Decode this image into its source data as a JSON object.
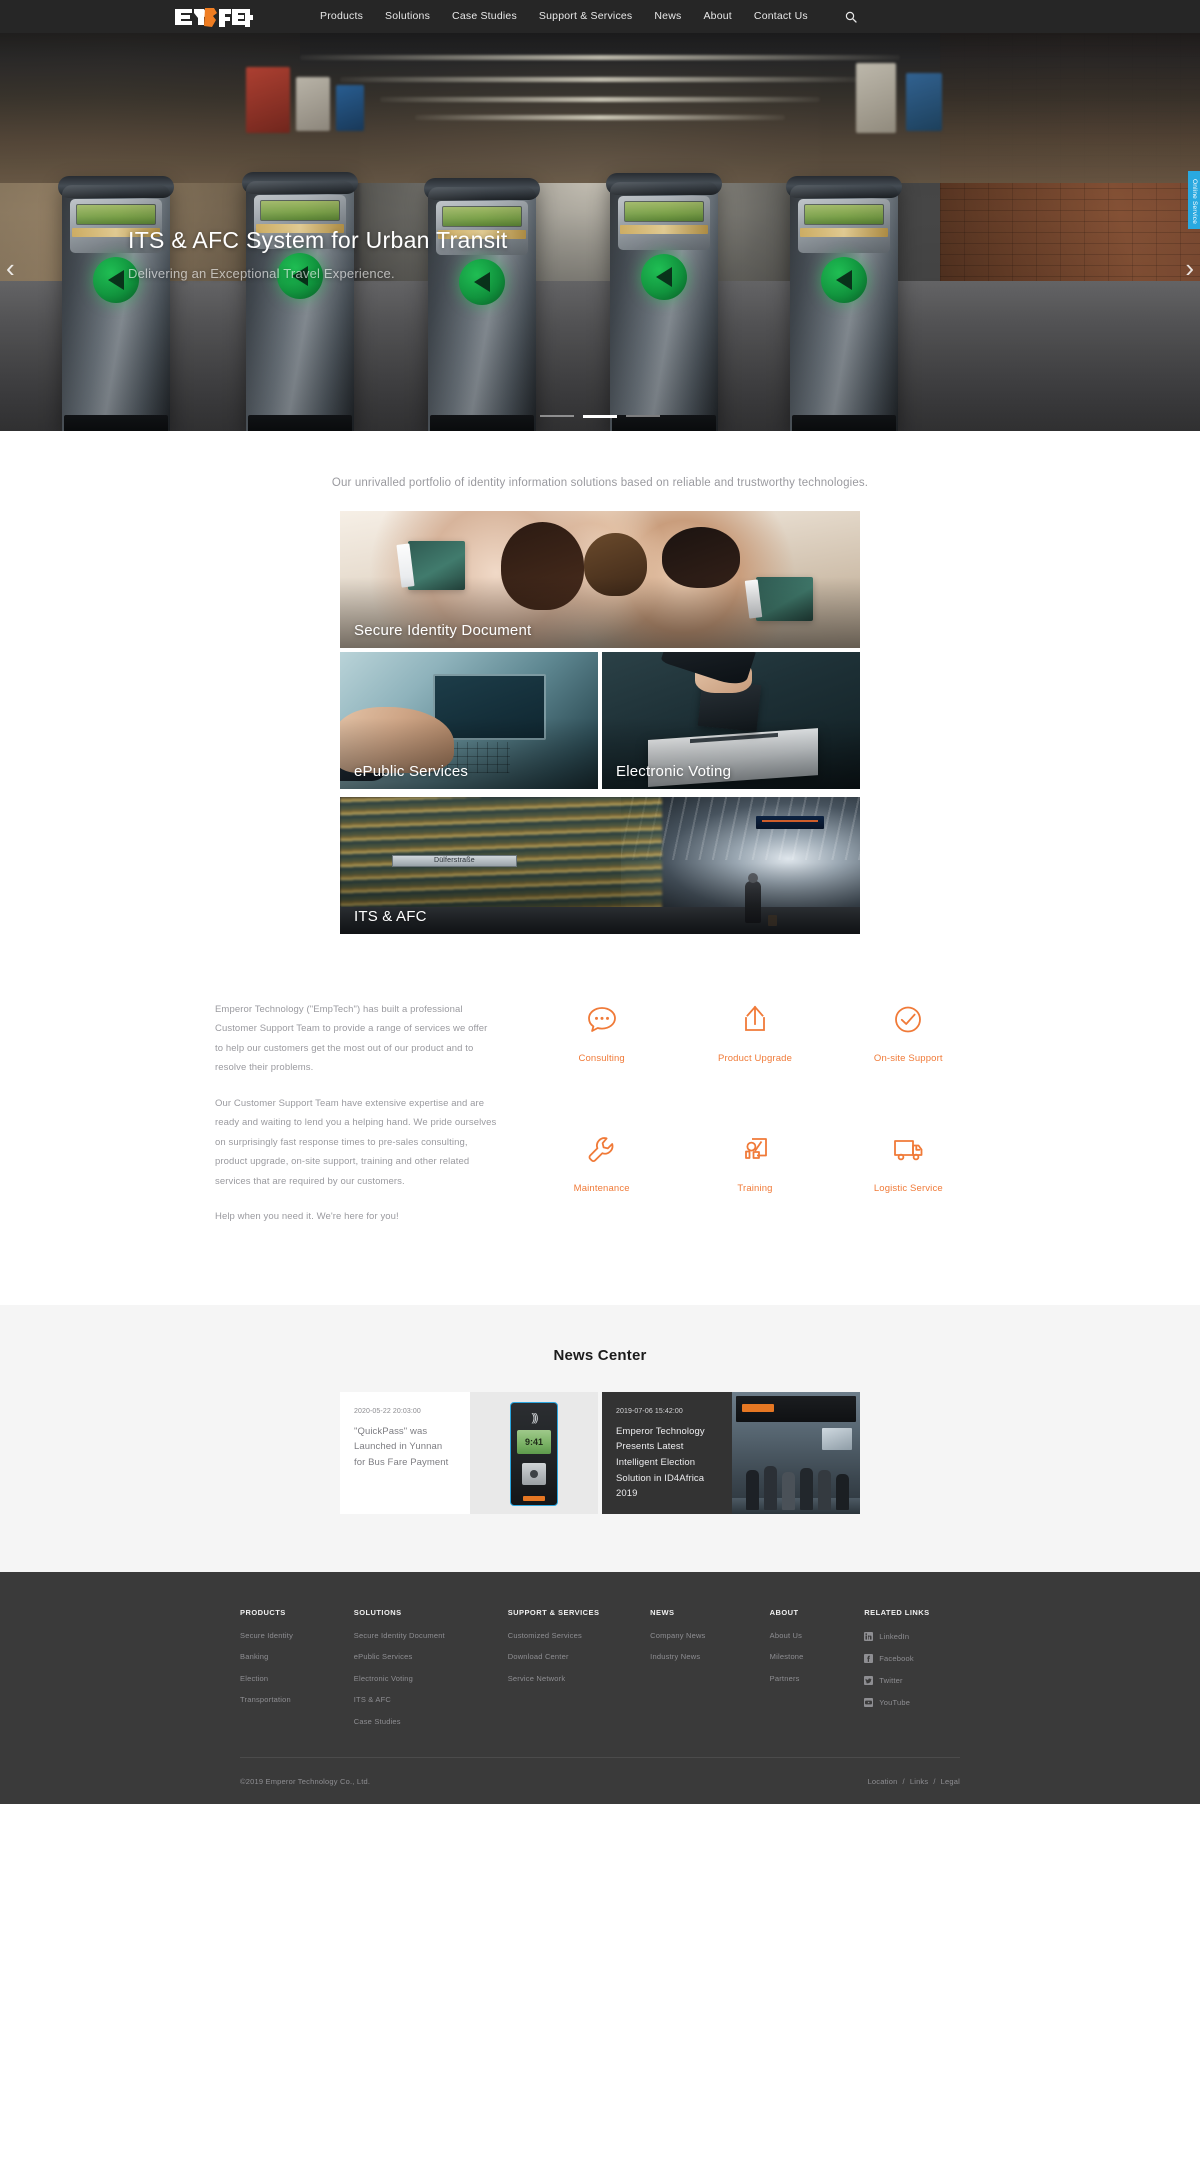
{
  "header": {
    "logo_text": "EMPTECH",
    "nav": [
      {
        "label": "Products"
      },
      {
        "label": "Solutions"
      },
      {
        "label": "Case Studies"
      },
      {
        "label": "Support & Services"
      },
      {
        "label": "News"
      },
      {
        "label": "About"
      },
      {
        "label": "Contact Us"
      }
    ],
    "search_icon": "search-icon"
  },
  "hero": {
    "title": "ITS & AFC System for Urban Transit",
    "subtitle": "Delivering an Exceptional Travel Experience.",
    "prev_label": "‹",
    "next_label": "›",
    "slide_count": 3,
    "active_slide": 2,
    "online_service_tab": "Online Service"
  },
  "tagline": "Our unrivalled portfolio of identity information solutions based on reliable and trustworthy technologies.",
  "tiles": [
    {
      "label": "Secure Identity Document",
      "art": "family-passport"
    },
    {
      "label": "ePublic Services",
      "art": "atm-kiosk"
    },
    {
      "label": "Electronic Voting",
      "art": "ballot-box"
    },
    {
      "label": "ITS & AFC",
      "art": "metro-platform",
      "sign_text": "Dülferstraße"
    }
  ],
  "support": {
    "paragraphs": [
      "Emperor Technology (\"EmpTech\") has built a professional Customer Support Team to provide a range of services we offer to help our customers get the most out of our product and to resolve their problems.",
      "Our Customer Support Team have extensive expertise and are ready and waiting to lend you a helping hand. We pride ourselves on surprisingly fast response times to pre-sales consulting, product upgrade, on-site support, training and other related services that are required by our customers.",
      "Help when you need it. We're here for you!"
    ],
    "accent_color": "#f07a38",
    "services": [
      {
        "label": "Consulting",
        "icon": "chat-bubble-icon"
      },
      {
        "label": "Product Upgrade",
        "icon": "upload-icon"
      },
      {
        "label": "On-site Support",
        "icon": "check-circle-icon"
      },
      {
        "label": "Maintenance",
        "icon": "wrench-icon"
      },
      {
        "label": "Training",
        "icon": "presentation-icon"
      },
      {
        "label": "Logistic Service",
        "icon": "delivery-truck-icon"
      }
    ]
  },
  "news": {
    "title": "News Center",
    "cards": [
      {
        "date": "2020-05-22 20:03:00",
        "headline": "\"QuickPass\" was Launched in Yunnan for Bus Fare Payment",
        "theme": "light",
        "image": "bus-validator-device",
        "device_time": "9:41"
      },
      {
        "date": "2019-07-06 15:42:00",
        "headline": "Emperor Technology Presents Latest Intelligent Election Solution in ID4Africa 2019",
        "theme": "dark",
        "image": "exhibition-booth"
      }
    ]
  },
  "footer": {
    "columns": [
      {
        "title": "PRODUCTS",
        "links": [
          "Secure Identity",
          "Banking",
          "Election",
          "Transportation"
        ]
      },
      {
        "title": "SOLUTIONS",
        "links": [
          "Secure Identity Document",
          "ePublic Services",
          "Electronic Voting",
          "ITS & AFC",
          "Case Studies"
        ]
      },
      {
        "title": "SUPPORT & SERVICES",
        "links": [
          "Customized Services",
          "Download Center",
          "Service Network"
        ]
      },
      {
        "title": "NEWS",
        "links": [
          "Company News",
          "Industry News"
        ]
      },
      {
        "title": "ABOUT",
        "links": [
          "About Us",
          "Milestone",
          "Partners"
        ]
      }
    ],
    "related": {
      "title": "RELATED LINKS",
      "links": [
        {
          "label": "LinkedIn",
          "icon": "linkedin-icon"
        },
        {
          "label": "Facebook",
          "icon": "facebook-icon"
        },
        {
          "label": "Twitter",
          "icon": "twitter-icon"
        },
        {
          "label": "YouTube",
          "icon": "youtube-icon"
        }
      ]
    },
    "copyright": "©2019 Emperor Technology Co., Ltd.",
    "legal": [
      {
        "label": "Location"
      },
      {
        "label": "Links"
      },
      {
        "label": "Legal"
      }
    ],
    "separator": "/"
  }
}
